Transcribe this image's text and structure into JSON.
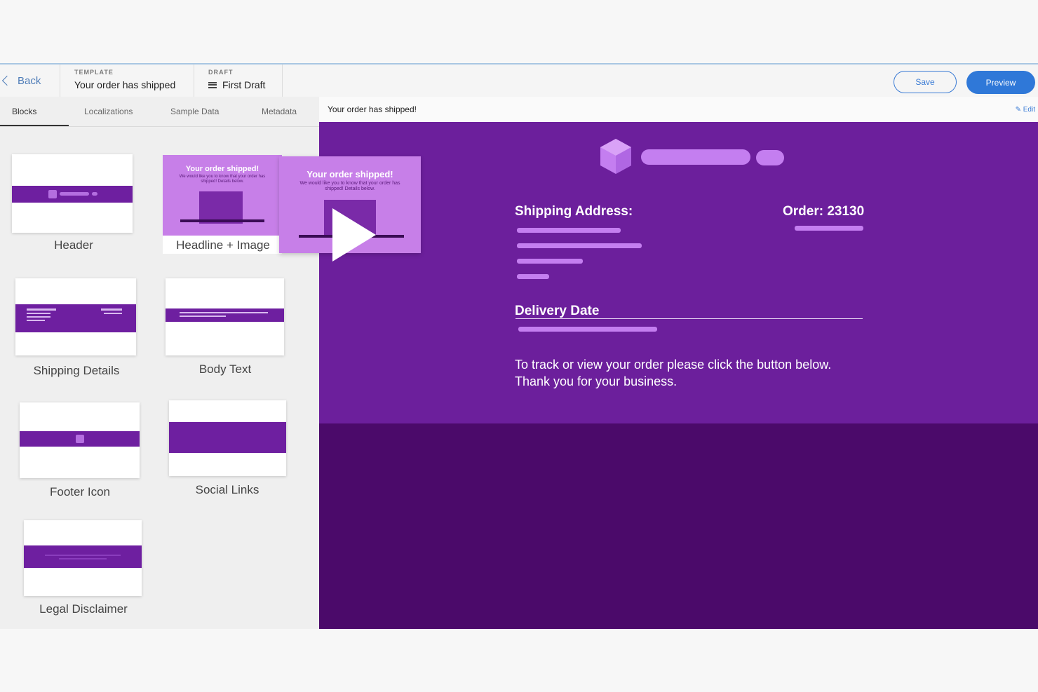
{
  "topbar": {
    "back_label": "Back",
    "template_caption": "TEMPLATE",
    "template_value": "Your order has shipped",
    "draft_caption": "DRAFT",
    "draft_value": "First Draft",
    "save_label": "Save",
    "preview_label": "Preview"
  },
  "tabs": [
    "Blocks",
    "Localizations",
    "Sample Data",
    "Metadata"
  ],
  "blocks": {
    "header": "Header",
    "headline_image": "Headline + Image",
    "shipping_details": "Shipping Details",
    "body_text": "Body Text",
    "footer_icon": "Footer Icon",
    "social_links": "Social Links",
    "legal_disclaimer": "Legal Disclaimer"
  },
  "drag_preview": {
    "title": "Your order shipped!",
    "subtitle": "We would like you to know that your order has shipped! Details below."
  },
  "preview": {
    "title": "Your order has shipped!",
    "edit_label": "Edit",
    "shipping_address_label": "Shipping Address:",
    "order_label": "Order: 23130",
    "delivery_date_label": "Delivery Date",
    "body_line1": "To track or view your order please click the button below.",
    "body_line2": "Thank you for your business."
  },
  "colors": {
    "accent_purple": "#6c1f9c",
    "dark_purple": "#4b0a6a",
    "light_purple": "#c47ef0",
    "preview_blue": "#2f78d8"
  },
  "icons": [
    "chevron-left-icon",
    "menu-icon",
    "pencil-icon",
    "cube-logo-icon",
    "play-icon"
  ]
}
